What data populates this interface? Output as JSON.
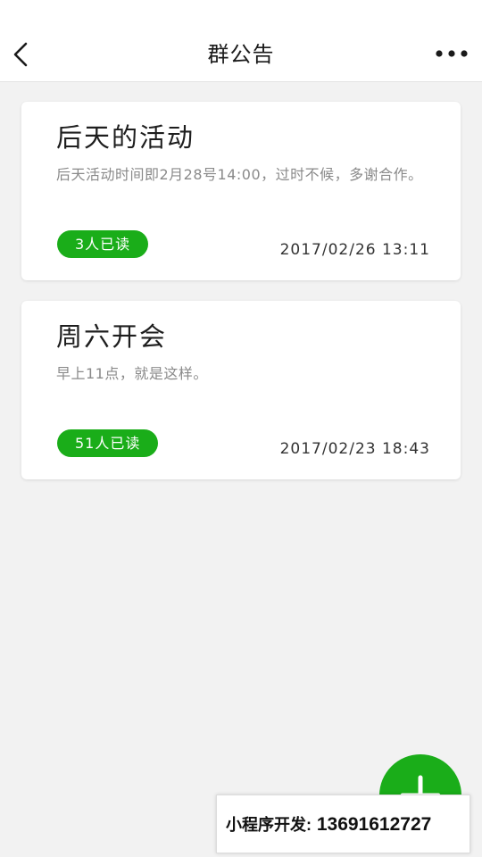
{
  "header": {
    "title": "群公告",
    "back_icon": "chevron-left-icon",
    "more_icon": "more-dots-icon"
  },
  "announcements": [
    {
      "title": "后天的活动",
      "body": "后天活动时间即2月28号14:00，过时不候，多谢合作。",
      "read_count": "3人已读",
      "timestamp": "2017/02/26 13:11"
    },
    {
      "title": "周六开会",
      "body": "早上11点，就是这样。",
      "read_count": "51人已读",
      "timestamp": "2017/02/23 18:43"
    }
  ],
  "fab": {
    "icon": "plus-icon"
  },
  "watermark": {
    "label": "小程序开发:",
    "phone": "13691612727"
  },
  "colors": {
    "accent": "#1aad19",
    "background": "#f2f2f2",
    "card": "#ffffff",
    "title_text": "#1e1e1e",
    "secondary_text": "#8a8a8a"
  }
}
